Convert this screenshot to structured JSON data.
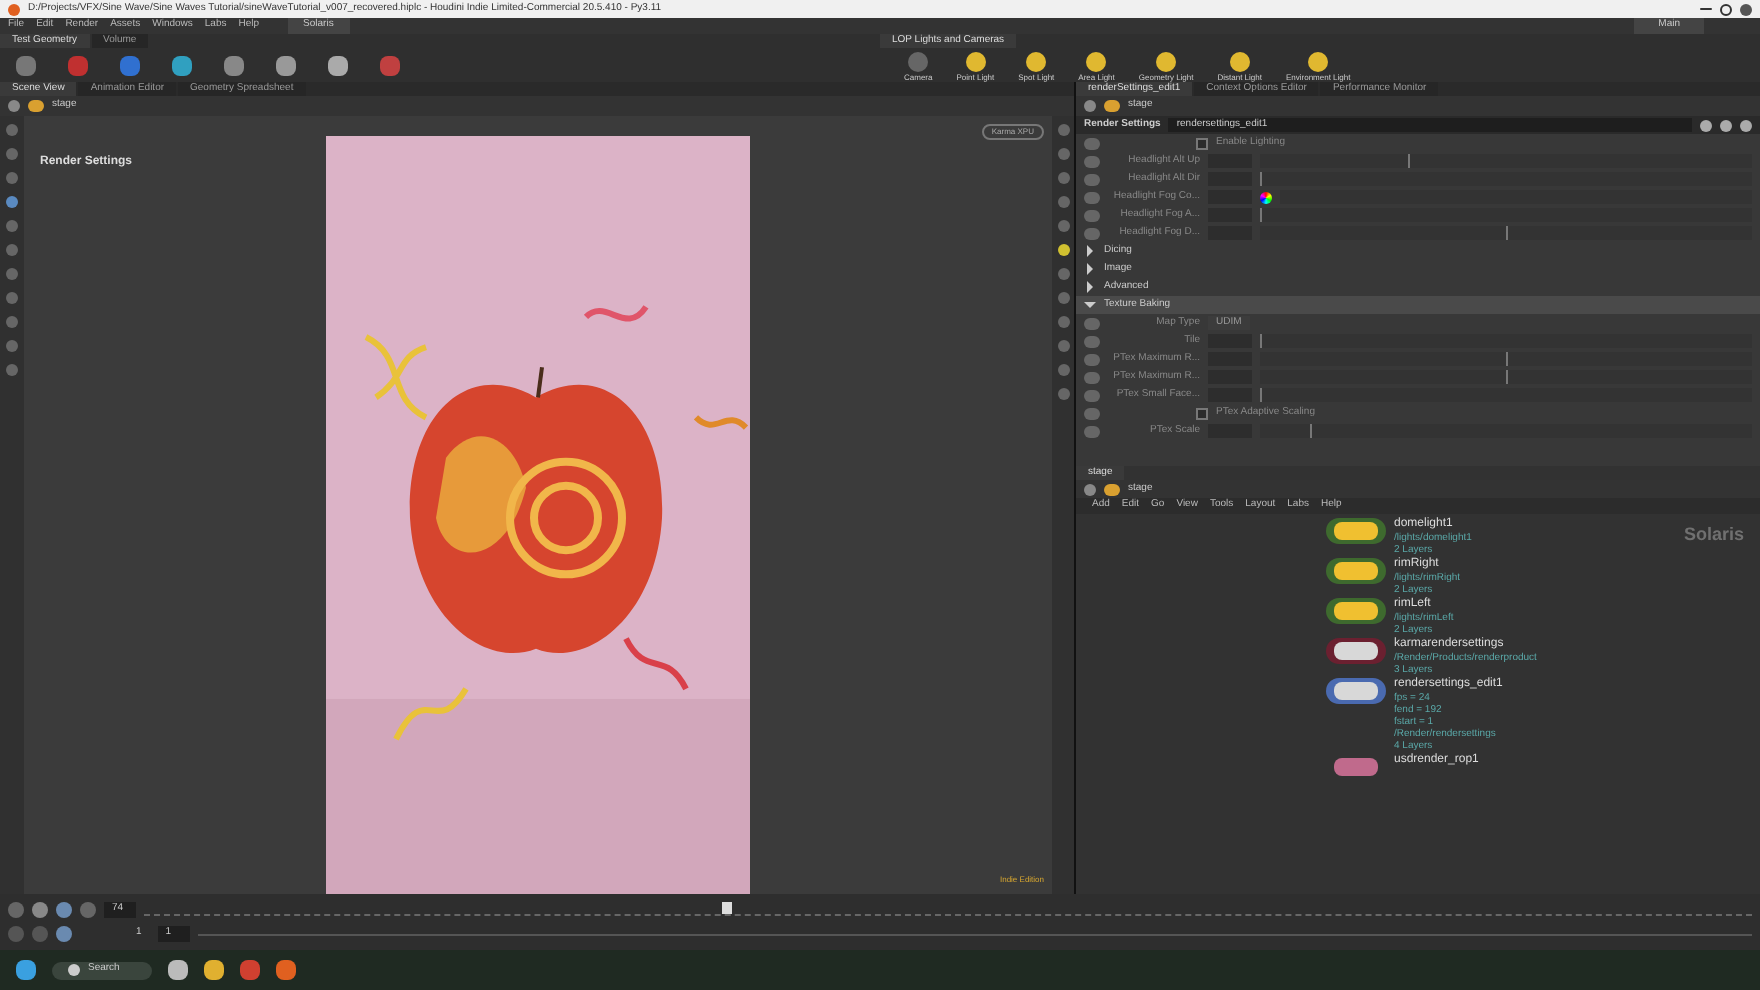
{
  "window": {
    "title": "D:/Projects/VFX/Sine Wave/Sine Waves Tutorial/sineWaveTutorial_v007_recovered.hiplc - Houdini Indie Limited-Commercial 20.5.410 - Py3.11"
  },
  "menu": [
    "File",
    "Edit",
    "Render",
    "Assets",
    "Windows",
    "Labs",
    "Help"
  ],
  "desktop": "Solaris",
  "layout": "Main",
  "shelf_left": {
    "tabs": [
      {
        "label": "Test Geometry",
        "selected": true
      },
      {
        "label": "Volume",
        "selected": false
      }
    ]
  },
  "shelf_right": {
    "tabs": [
      {
        "label": "LOP Lights and Cameras",
        "selected": true
      }
    ],
    "tools": [
      "Camera",
      "Point Light",
      "Spot Light",
      "Area Light",
      "Geometry Light",
      "Distant Light",
      "Environment Light"
    ]
  },
  "left_pane": {
    "tabs": [
      {
        "label": "Scene View",
        "selected": true
      },
      {
        "label": "Animation Editor",
        "selected": false
      },
      {
        "label": "Geometry Spreadsheet",
        "selected": false
      }
    ],
    "path": "stage",
    "overlay": "Render Settings",
    "renderer": "Karma XPU",
    "edition": "Indie Edition"
  },
  "right_pane": {
    "tabs": [
      {
        "label": "renderSettings_edit1",
        "selected": true
      },
      {
        "label": "Context Options Editor",
        "selected": false
      },
      {
        "label": "Performance Monitor",
        "selected": false
      }
    ],
    "path": "stage"
  },
  "params": {
    "type_label": "Render Settings",
    "node_name": "rendersettings_edit1",
    "rows": [
      {
        "kind": "checkbox",
        "label": "Enable Lighting",
        "checked": false
      },
      {
        "kind": "slider",
        "label": "Headlight Alt Up",
        "level": 0.3
      },
      {
        "kind": "slider",
        "label": "Headlight Alt Dir",
        "level": 0
      },
      {
        "kind": "color",
        "label": "Headlight Fog Co..."
      },
      {
        "kind": "slider",
        "label": "Headlight Fog A...",
        "level": 0
      },
      {
        "kind": "slider",
        "label": "Headlight Fog D...",
        "level": 0.5
      },
      {
        "kind": "section",
        "label": "Dicing",
        "expanded": false
      },
      {
        "kind": "section",
        "label": "Image",
        "expanded": false
      },
      {
        "kind": "section",
        "label": "Advanced",
        "expanded": false
      },
      {
        "kind": "section",
        "label": "Texture Baking",
        "expanded": true
      },
      {
        "kind": "menu",
        "label": "Map Type",
        "value": "UDIM"
      },
      {
        "kind": "slider",
        "label": "Tile",
        "level": 0
      },
      {
        "kind": "slider",
        "label": "PTex Maximum R...",
        "level": 0.5
      },
      {
        "kind": "slider",
        "label": "PTex Maximum R...",
        "level": 0.5
      },
      {
        "kind": "slider",
        "label": "PTex Small Face...",
        "level": 0
      },
      {
        "kind": "checkbox",
        "label": "PTex Adaptive Scaling",
        "checked": false
      },
      {
        "kind": "slider",
        "label": "PTex Scale",
        "level": 0.1
      }
    ]
  },
  "network": {
    "tabs": [
      {
        "label": "stage",
        "selected": true
      }
    ],
    "path": "stage",
    "menu": [
      "Add",
      "Edit",
      "Go",
      "View",
      "Tools",
      "Layout",
      "Labs",
      "Help"
    ],
    "context": "Solaris",
    "nodes": [
      {
        "kind": "light",
        "name": "domelight1",
        "info": [
          "/lights/domelight1",
          "2 Layers"
        ]
      },
      {
        "kind": "light",
        "name": "rimRight",
        "info": [
          "/lights/rimRight",
          "2 Layers"
        ]
      },
      {
        "kind": "light",
        "name": "rimLeft",
        "info": [
          "/lights/rimLeft",
          "2 Layers"
        ]
      },
      {
        "kind": "settings",
        "name": "karmarendersettings",
        "info": [
          "/Render/Products/renderproduct",
          "3 Layers"
        ]
      },
      {
        "kind": "edit",
        "name": "rendersettings_edit1",
        "info": [
          "fps = 24",
          "fend = 192",
          "fstart = 1",
          "/Render/rendersettings",
          "4 Layers"
        ]
      },
      {
        "kind": "rop",
        "name": "usdrender_rop1"
      }
    ]
  },
  "timeline": {
    "frame": "74",
    "start": "1",
    "end": "1",
    "level": 0.36
  },
  "taskbar": {
    "search": "Search"
  }
}
